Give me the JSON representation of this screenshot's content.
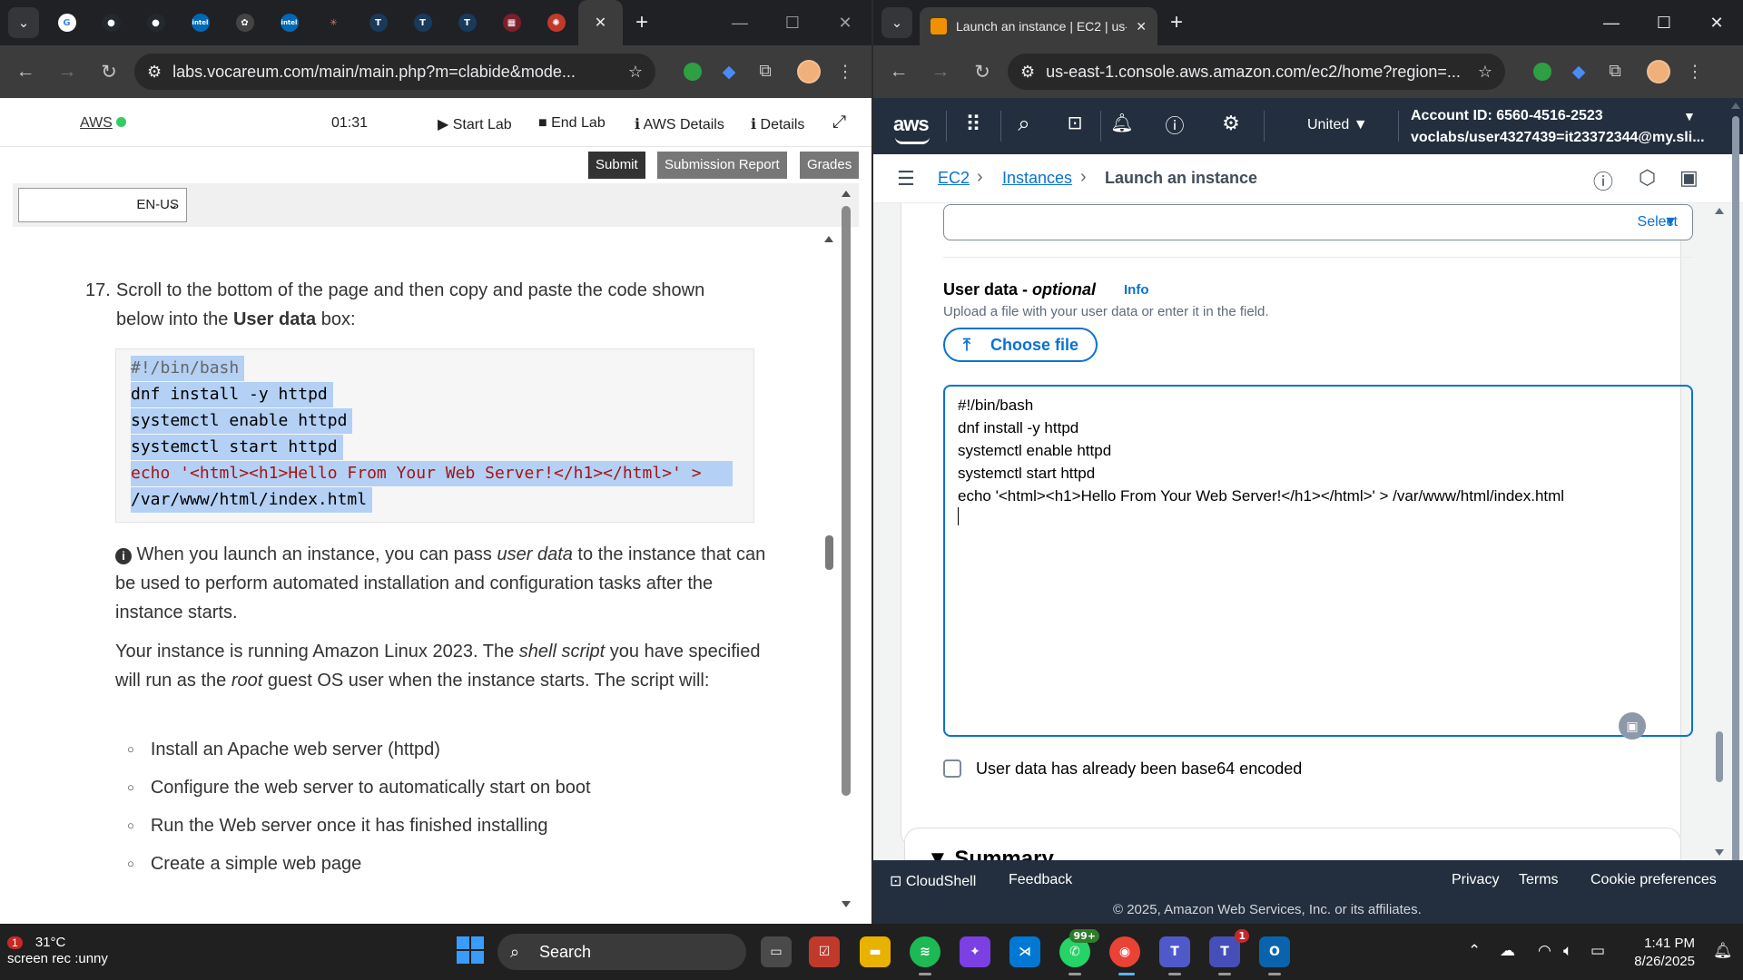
{
  "left_browser": {
    "tab_menu_icon": "chevron-down-icon",
    "pinned_tabs": [
      {
        "name": "google",
        "glyph": "G",
        "color": "#ffffff",
        "text_color": "#4285f4"
      },
      {
        "name": "github",
        "glyph": "●",
        "color": "#24292e",
        "text_color": "#ffffff"
      },
      {
        "name": "github",
        "glyph": "●",
        "color": "#24292e",
        "text_color": "#ffffff"
      },
      {
        "name": "intel",
        "glyph": "intel",
        "color": "#0068b5",
        "text_color": "#ffffff"
      },
      {
        "name": "chatgpt",
        "glyph": "✿",
        "color": "#444444",
        "text_color": "#ffffff"
      },
      {
        "name": "intel",
        "glyph": "intel",
        "color": "#0068b5",
        "text_color": "#ffffff"
      },
      {
        "name": "claude",
        "glyph": "✳",
        "color": "#202124",
        "text_color": "#d97757"
      },
      {
        "name": "app-t",
        "glyph": "T",
        "color": "#1a3a5c",
        "text_color": "#ffffff"
      },
      {
        "name": "app-t",
        "glyph": "T",
        "color": "#1a3a5c",
        "text_color": "#ffffff"
      },
      {
        "name": "app-t",
        "glyph": "T",
        "color": "#1a3a5c",
        "text_color": "#ffffff"
      },
      {
        "name": "university",
        "glyph": "▦",
        "color": "#7a1f2b",
        "text_color": "#ffffff"
      },
      {
        "name": "vocareum",
        "glyph": "✺",
        "color": "#c0392b",
        "text_color": "#ffffff"
      }
    ],
    "url": "labs.vocareum.com/main/main.php?m=clabide&mode...",
    "lab_header": {
      "aws_label": "AWS",
      "timer": "01:31",
      "start_lab": "▶ Start Lab",
      "end_lab": "■ End Lab",
      "aws_details": "ℹ AWS Details",
      "details": "ℹ Details"
    },
    "submit_bar": {
      "submit": "Submit",
      "submission_report": "Submission Report",
      "grades": "Grades"
    },
    "language_select": "EN-US",
    "step_number": "17.",
    "step_text_a": "Scroll to the bottom of the page and then copy and paste the code shown below into the ",
    "step_text_bold": "User data",
    "step_text_b": " box:",
    "code_lines": [
      "#!/bin/bash",
      "dnf install -y httpd",
      "systemctl enable httpd",
      "systemctl start httpd",
      "echo '<html><h1>Hello From Your Web Server!</h1></html>' >",
      "/var/www/html/index.html"
    ],
    "info_para_a": " When you launch an instance, you can pass ",
    "info_para_em": "user data",
    "info_para_b": " to the instance that can be used to perform automated installation and configuration tasks after the instance starts.",
    "para2_a": "Your instance is running Amazon Linux 2023. The ",
    "para2_em1": "shell script",
    "para2_b": " you have specified will run as the ",
    "para2_em2": "root",
    "para2_c": " guest OS user when the instance starts. The script will:",
    "bullets": [
      "Install an Apache web server (httpd)",
      "Configure the web server to automatically start on boot",
      "Run the Web server once it has finished installing",
      "Create a simple web page"
    ]
  },
  "right_browser": {
    "tab_title": "Launch an instance | EC2 | us-e",
    "url": "us-east-1.console.aws.amazon.com/ec2/home?region=...",
    "aws_nav": {
      "logo": "aws",
      "region": "United ▼",
      "account_id": "Account ID: 6560-4516-2523",
      "account_user": "voclabs/user4327439=it23372344@my.sli..."
    },
    "breadcrumb": {
      "ec2": "EC2",
      "instances": "Instances",
      "current": "Launch an instance"
    },
    "select_placeholder": "Select",
    "user_data_label": "User data - ",
    "user_data_optional": "optional",
    "info_link": "Info",
    "user_data_desc": "Upload a file with your user data or enter it in the field.",
    "choose_file": "Choose file",
    "user_data_lines": [
      "#!/bin/bash",
      "dnf install -y httpd",
      "systemctl enable httpd",
      "systemctl start httpd",
      "echo '<html><h1>Hello From Your Web Server!</h1></html>' > /var/www/html/index.html"
    ],
    "base64_checkbox": "User data has already been base64 encoded",
    "summary_title": "▼ Summary",
    "footer": {
      "cloudshell": "CloudShell",
      "feedback": "Feedback",
      "privacy": "Privacy",
      "terms": "Terms",
      "cookie": "Cookie preferences",
      "copyright": "© 2025, Amazon Web Services, Inc. or its affiliates."
    }
  },
  "taskbar": {
    "weather_temp": "31°C",
    "weather_badge": "1",
    "weather_desc": "screen rec :unny",
    "search": "Search",
    "chat_badge": "99+",
    "teams_badge": "1",
    "time": "1:41 PM",
    "date": "8/26/2025"
  },
  "colors": {
    "aws_squid": "#232f3e",
    "aws_link": "#0972d3",
    "chrome_dark": "#202124",
    "submit_dark": "#333333",
    "submit_gray": "#777777"
  }
}
